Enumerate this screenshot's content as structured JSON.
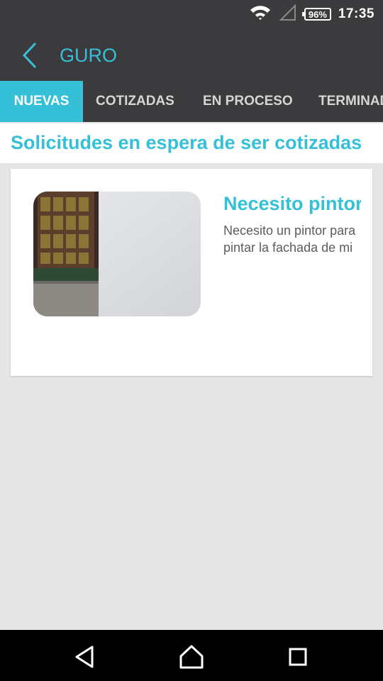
{
  "status_bar": {
    "time": "17:35",
    "battery": "96%"
  },
  "app_bar": {
    "title": "GURO"
  },
  "tabs": [
    {
      "label": "NUEVAS",
      "active": true
    },
    {
      "label": "COTIZADAS",
      "active": false
    },
    {
      "label": "EN PROCESO",
      "active": false
    },
    {
      "label": "TERMINADAS",
      "active": false
    }
  ],
  "section": {
    "title": "Solicitudes en espera de ser cotizadas"
  },
  "requests": [
    {
      "title": "Necesito pintor",
      "description_line1": "Necesito un pintor para",
      "description_line2": "pintar la fachada de mi"
    }
  ],
  "colors": {
    "accent": "#35c0d8",
    "bar": "#3b3a3c",
    "background": "#e5e5e5"
  }
}
